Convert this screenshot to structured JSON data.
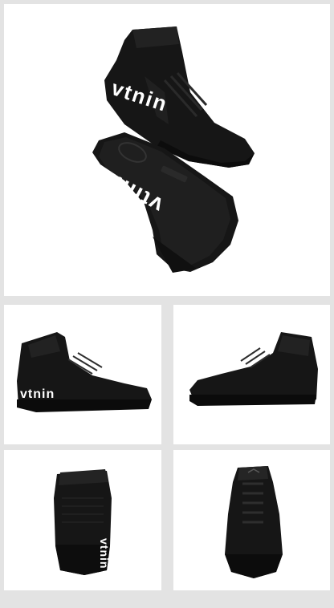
{
  "product": {
    "brand_mark": "vtnin",
    "sole_brand_mark": "vtnin"
  },
  "colors": {
    "page_background": "#e3e3e3",
    "panel_background": "#ffffff",
    "shoe_primary": "#141414",
    "shoe_highlight": "#2e2e2e",
    "brand_text": "#ffffff"
  },
  "views": [
    {
      "id": "hero",
      "name": "upper-and-sole-view"
    },
    {
      "id": "side-left",
      "name": "lateral-side-view"
    },
    {
      "id": "side-right",
      "name": "medial-side-view"
    },
    {
      "id": "back",
      "name": "heel-view"
    },
    {
      "id": "front",
      "name": "toe-view"
    }
  ]
}
